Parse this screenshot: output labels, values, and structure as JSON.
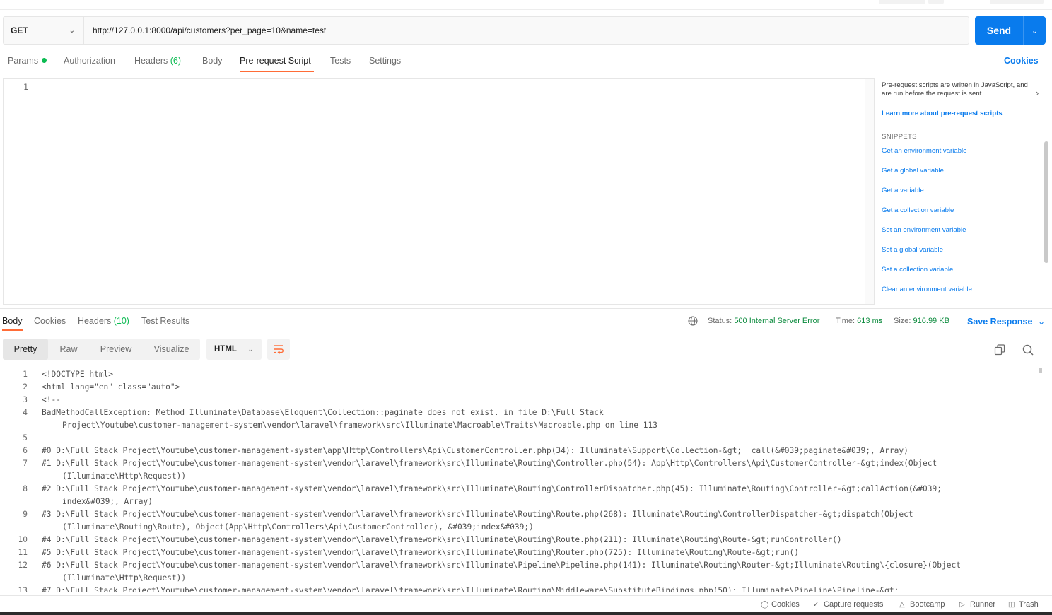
{
  "request": {
    "method": "GET",
    "url": "http://127.0.0.1:8000/api/customers?per_page=10&name=test",
    "send_label": "Send"
  },
  "request_tabs": {
    "params": "Params",
    "authorization": "Authorization",
    "headers": "Headers",
    "headers_count": "(6)",
    "body": "Body",
    "prerequest": "Pre-request Script",
    "tests": "Tests",
    "settings": "Settings",
    "cookies": "Cookies"
  },
  "editor": {
    "line": "1"
  },
  "snippets_panel": {
    "description": "Pre-request scripts are written in JavaScript, and are run before the request is sent.",
    "learn_more": "Learn more about pre-request scripts",
    "heading": "SNIPPETS",
    "items": [
      "Get an environment variable",
      "Get a global variable",
      "Get a variable",
      "Get a collection variable",
      "Set an environment variable",
      "Set a global variable",
      "Set a collection variable",
      "Clear an environment variable"
    ]
  },
  "response_tabs": {
    "body": "Body",
    "cookies": "Cookies",
    "headers": "Headers",
    "headers_count": "(10)",
    "test_results": "Test Results"
  },
  "response_meta": {
    "status_label": "Status:",
    "status_value": "500 Internal Server Error",
    "time_label": "Time:",
    "time_value": "613 ms",
    "size_label": "Size:",
    "size_value": "916.99 KB",
    "save_response": "Save Response"
  },
  "view_modes": [
    "Pretty",
    "Raw",
    "Preview",
    "Visualize"
  ],
  "format": "HTML",
  "code_lines": [
    {
      "n": "1",
      "t": "<!DOCTYPE html>"
    },
    {
      "n": "2",
      "t": "<html lang=\"en\" class=\"auto\">"
    },
    {
      "n": "3",
      "t": "<!--"
    },
    {
      "n": "4",
      "t": "BadMethodCallException: Method Illuminate\\Database\\Eloquent\\Collection::paginate does not exist. in file D:\\Full Stack"
    },
    {
      "n": "",
      "t": "Project\\Youtube\\customer-management-system\\vendor\\laravel\\framework\\src\\Illuminate\\Macroable\\Traits\\Macroable.php on line 113",
      "cont": true
    },
    {
      "n": "5",
      "t": ""
    },
    {
      "n": "6",
      "t": "#0 D:\\Full Stack Project\\Youtube\\customer-management-system\\app\\Http\\Controllers\\Api\\CustomerController.php(34): Illuminate\\Support\\Collection-&gt;__call(&#039;paginate&#039;, Array)"
    },
    {
      "n": "7",
      "t": "#1 D:\\Full Stack Project\\Youtube\\customer-management-system\\vendor\\laravel\\framework\\src\\Illuminate\\Routing\\Controller.php(54): App\\Http\\Controllers\\Api\\CustomerController-&gt;index(Object"
    },
    {
      "n": "",
      "t": "(Illuminate\\Http\\Request))",
      "cont": true
    },
    {
      "n": "8",
      "t": "#2 D:\\Full Stack Project\\Youtube\\customer-management-system\\vendor\\laravel\\framework\\src\\Illuminate\\Routing\\ControllerDispatcher.php(45): Illuminate\\Routing\\Controller-&gt;callAction(&#039;"
    },
    {
      "n": "",
      "t": "index&#039;, Array)",
      "cont": true
    },
    {
      "n": "9",
      "t": "#3 D:\\Full Stack Project\\Youtube\\customer-management-system\\vendor\\laravel\\framework\\src\\Illuminate\\Routing\\Route.php(268): Illuminate\\Routing\\ControllerDispatcher-&gt;dispatch(Object"
    },
    {
      "n": "",
      "t": "(Illuminate\\Routing\\Route), Object(App\\Http\\Controllers\\Api\\CustomerController), &#039;index&#039;)",
      "cont": true
    },
    {
      "n": "10",
      "t": "#4 D:\\Full Stack Project\\Youtube\\customer-management-system\\vendor\\laravel\\framework\\src\\Illuminate\\Routing\\Route.php(211): Illuminate\\Routing\\Route-&gt;runController()"
    },
    {
      "n": "11",
      "t": "#5 D:\\Full Stack Project\\Youtube\\customer-management-system\\vendor\\laravel\\framework\\src\\Illuminate\\Routing\\Router.php(725): Illuminate\\Routing\\Route-&gt;run()"
    },
    {
      "n": "12",
      "t": "#6 D:\\Full Stack Project\\Youtube\\customer-management-system\\vendor\\laravel\\framework\\src\\Illuminate\\Pipeline\\Pipeline.php(141): Illuminate\\Routing\\Router-&gt;Illuminate\\Routing\\{closure}(Object"
    },
    {
      "n": "",
      "t": "(Illuminate\\Http\\Request))",
      "cont": true
    },
    {
      "n": "13",
      "t": "#7 D:\\Full Stack Project\\Youtube\\customer-management-system\\vendor\\laravel\\framework\\src\\Illuminate\\Routing\\Middleware\\SubstituteBindings.php(50): Illuminate\\Pipeline\\Pipeline-&gt;"
    }
  ],
  "footer": {
    "cookies": "Cookies",
    "capture": "Capture requests",
    "bootcamp": "Bootcamp",
    "runner": "Runner",
    "trash": "Trash"
  },
  "colors": {
    "accent": "#ff6c37",
    "primary": "#097bed",
    "success": "#0cbb52"
  }
}
